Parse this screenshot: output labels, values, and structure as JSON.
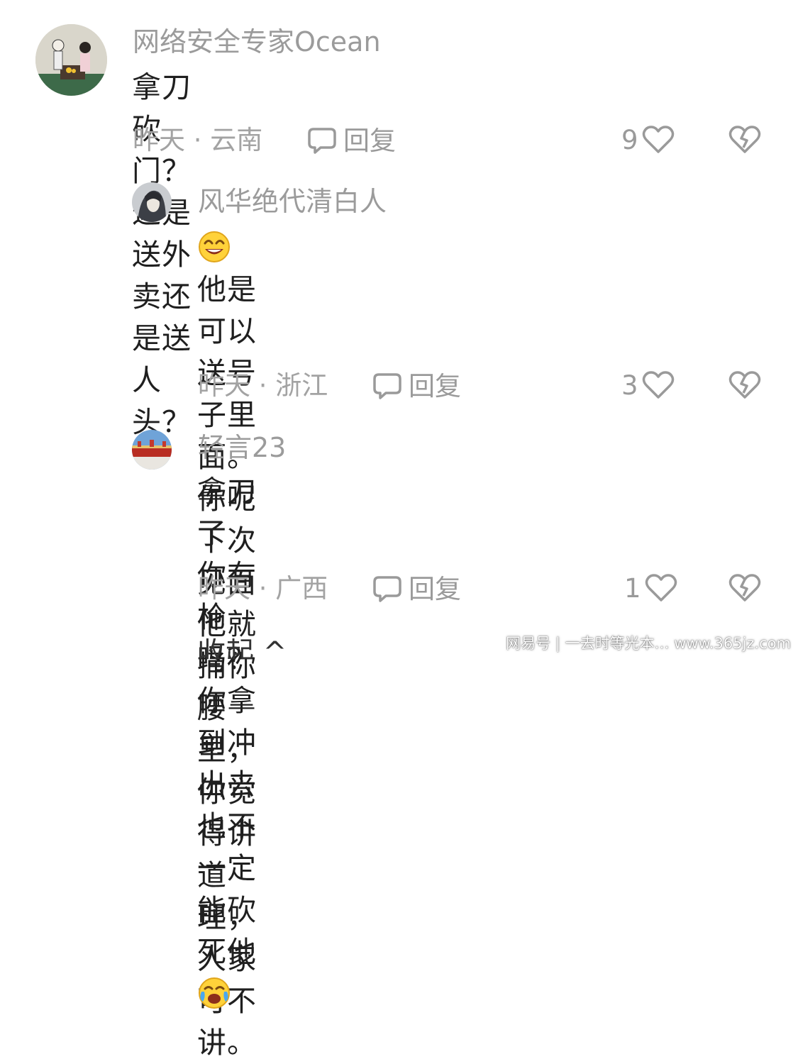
{
  "comments": [
    {
      "username": "网络安全专家Ocean",
      "text": "拿刀砍门？这是送外卖还是送人头？",
      "time_location": "昨天 · 云南",
      "reply_label": "回复",
      "likes": "9"
    },
    {
      "username": "风华绝代清白人",
      "text_line1": "他是可以送号子里面。 你呢   下次",
      "text_line2": "见面他就捅你腰里，你觉得讲道理，",
      "text_line3": "人家可不讲。",
      "time_location": "昨天 · 浙江",
      "reply_label": "回复",
      "likes": "3"
    },
    {
      "username": "轻言23",
      "text_line1": "拿刀了 你有枪吗？ 你拿到冲出去也不",
      "text_line2": "一定能砍死他",
      "time_location": "昨天 · 广西",
      "reply_label": "回复",
      "likes": "1"
    }
  ],
  "collapse_label": "收起 ^",
  "watermark": "网易号 | 一去时等光本…  www.365jz.com",
  "icons": {
    "reply": "chat-bubble-icon",
    "like": "heart-outline-icon",
    "dislike": "broken-heart-icon"
  },
  "colors": {
    "muted": "#9b9b9b",
    "text": "#1f1f1f"
  }
}
